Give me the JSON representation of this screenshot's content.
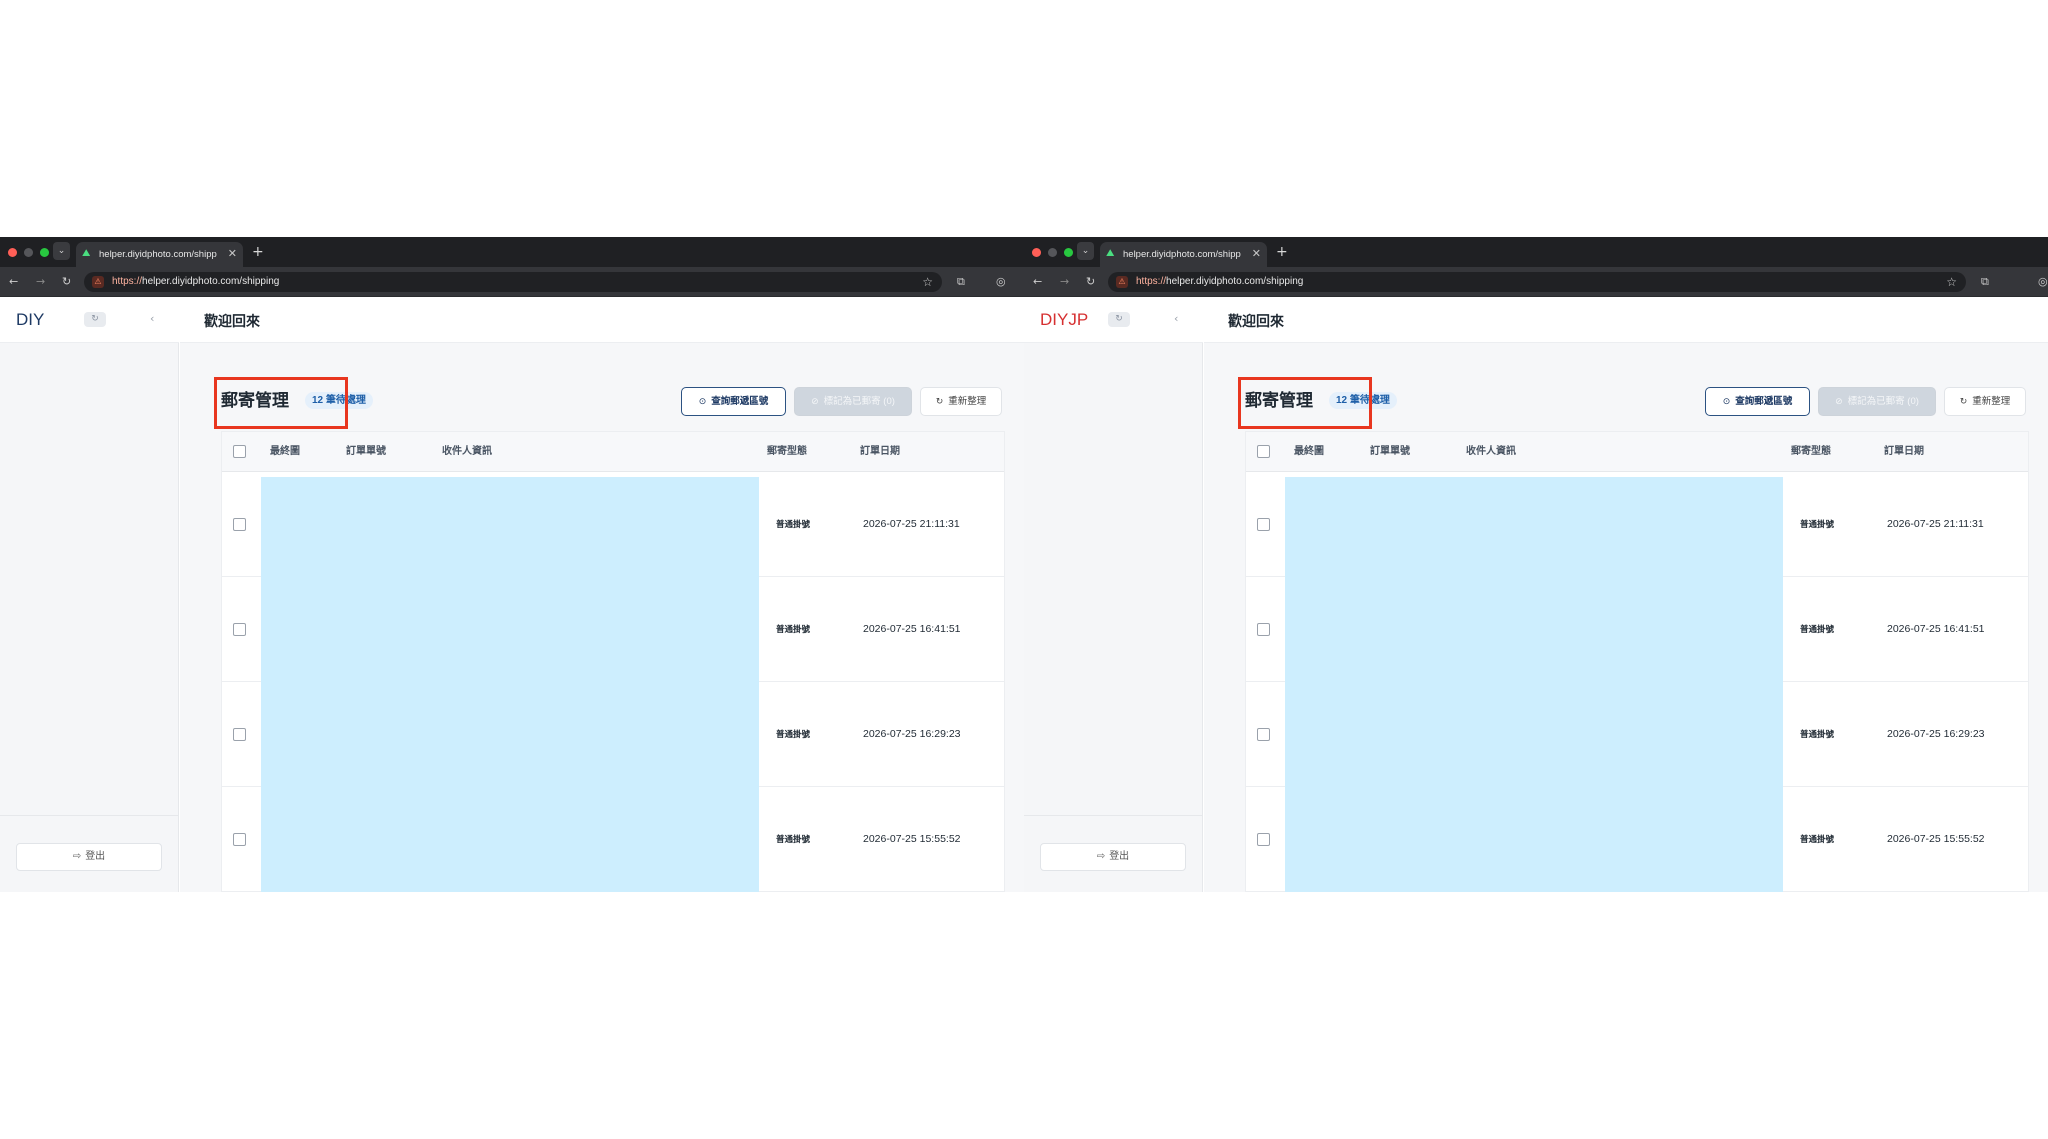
{
  "browser": {
    "tab_title": "helper.diyidphoto.com/shipping",
    "url_scheme": "https://",
    "url_rest": "helper.diyidphoto.com/shipping"
  },
  "panels": [
    {
      "brand": "DIY",
      "brand_color": "#1e3a64",
      "logout_label": "登出",
      "welcome": "歡迎回來",
      "section_title": "郵寄管理",
      "pending_badge": "12 筆待處理",
      "buttons": {
        "query": "查詢郵遞區號",
        "mark_shipped": "標記為已郵寄 (0)",
        "refresh": "重新整理"
      },
      "columns": [
        "最終圖",
        "訂單單號",
        "收件人資訊",
        "郵寄型態",
        "訂單日期"
      ],
      "rows": [
        {
          "type": "普通掛號",
          "date": "2026-07-25 21:11:31"
        },
        {
          "type": "普通掛號",
          "date": "2026-07-25 16:41:51"
        },
        {
          "type": "普通掛號",
          "date": "2026-07-25 16:29:23"
        },
        {
          "type": "普通掛號",
          "date": "2026-07-25 15:55:52"
        }
      ]
    },
    {
      "brand": "DIYJP",
      "brand_color": "#d63031",
      "logout_label": "登出",
      "welcome": "歡迎回來",
      "section_title": "郵寄管理",
      "pending_badge": "12 筆待處理",
      "buttons": {
        "query": "查詢郵遞區號",
        "mark_shipped": "標記為已郵寄 (0)",
        "refresh": "重新整理"
      },
      "columns": [
        "最終圖",
        "訂單單號",
        "收件人資訊",
        "郵寄型態",
        "訂單日期"
      ],
      "rows": [
        {
          "type": "普通掛號",
          "date": "2026-07-25 21:11:31"
        },
        {
          "type": "普通掛號",
          "date": "2026-07-25 16:41:51"
        },
        {
          "type": "普通掛號",
          "date": "2026-07-25 16:29:23"
        },
        {
          "type": "普通掛號",
          "date": "2026-07-25 15:55:52"
        }
      ]
    }
  ],
  "icons": {
    "tab_dropdown": "chevron-down-icon",
    "favicon": "app-favicon-icon",
    "tab_close": "close-icon",
    "new_tab": "plus-icon",
    "back": "arrow-left-icon",
    "forward": "arrow-right-icon",
    "reload": "reload-icon",
    "site_info": "site-info-icon",
    "bookmark": "star-icon",
    "extensions": "extensions-icon",
    "profile": "profile-icon",
    "menu": "menu-dots-icon",
    "sidebar_refresh": "refresh-icon",
    "sidebar_collapse": "chevron-left-icon",
    "logout": "logout-icon",
    "query": "search-icon",
    "mark": "check-circle-icon",
    "refresh": "refresh-icon"
  },
  "colors": {
    "highlight_box": "#e8361f",
    "redaction": "#cdeefe",
    "badge_bg": "#e5f0fb",
    "primary": "#2c5282"
  }
}
